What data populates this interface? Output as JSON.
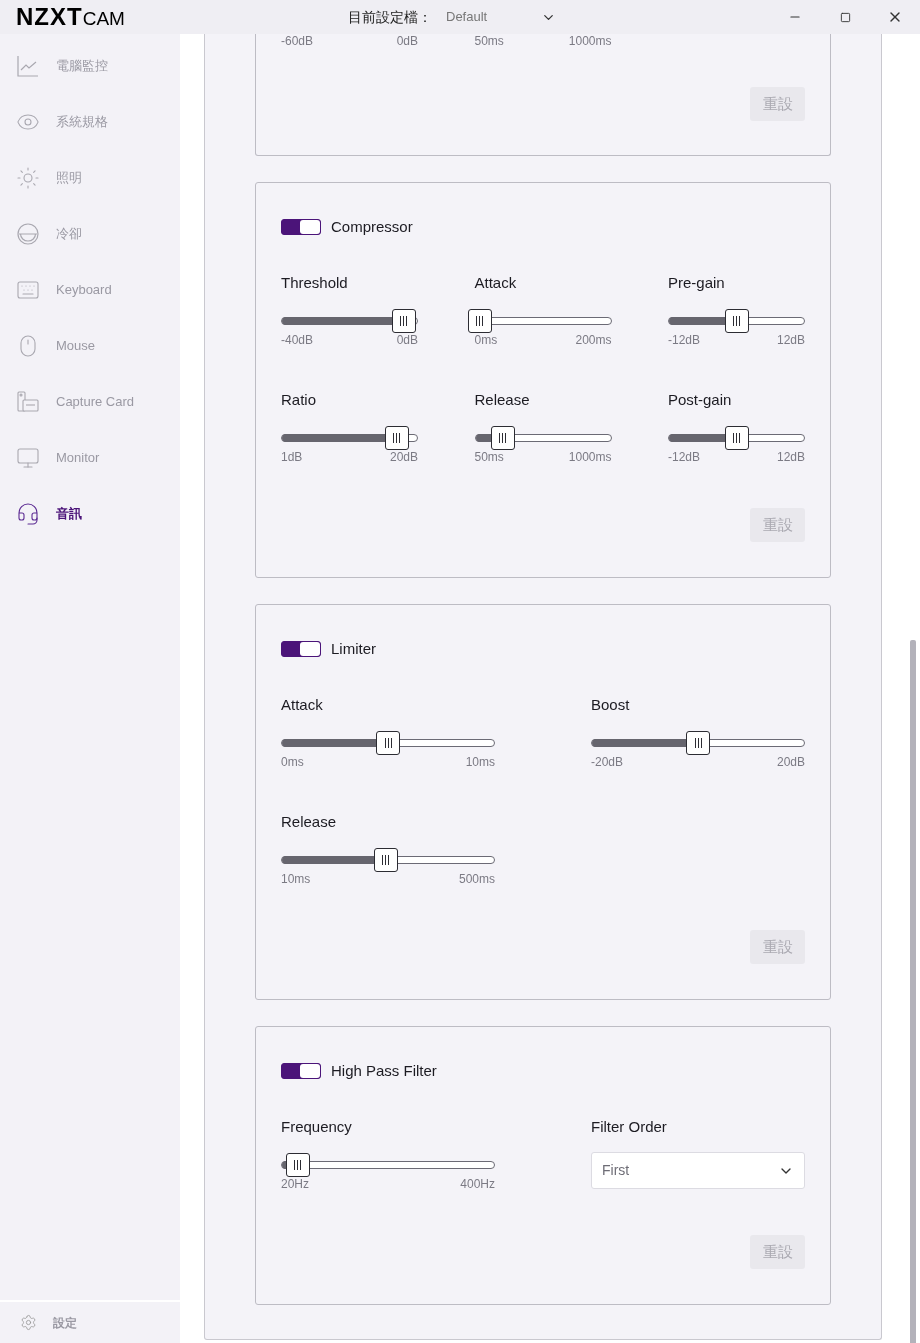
{
  "app": {
    "logo_bold": "NZXT",
    "logo_light": "CAM"
  },
  "profile": {
    "label": "目前設定檔：",
    "value": "Default"
  },
  "sidebar": {
    "items": [
      {
        "label": "電腦監控",
        "selected": false
      },
      {
        "label": "系統規格",
        "selected": false
      },
      {
        "label": "照明",
        "selected": false
      },
      {
        "label": "冷卻",
        "selected": false
      },
      {
        "label": "Keyboard",
        "selected": false
      },
      {
        "label": "Mouse",
        "selected": false
      },
      {
        "label": "Capture Card",
        "selected": false
      },
      {
        "label": "Monitor",
        "selected": false
      },
      {
        "label": "音訊",
        "selected": true
      }
    ],
    "footer": {
      "label": "設定"
    }
  },
  "partial_card": {
    "range_labels": [
      {
        "min": "-60dB",
        "max": "0dB"
      },
      {
        "min": "50ms",
        "max": "1000ms"
      }
    ],
    "reset": {
      "label": "重設",
      "disabled": true
    }
  },
  "cards": [
    {
      "title": "Compressor",
      "on": true,
      "controls": [
        {
          "kind": "slider",
          "label": "Threshold",
          "level": 0.9,
          "min": "-40dB",
          "max": "0dB"
        },
        {
          "kind": "slider",
          "label": "Attack",
          "level": 0.03,
          "min": "0ms",
          "max": "200ms"
        },
        {
          "kind": "slider",
          "label": "Pre-gain",
          "level": 0.5,
          "min": "-12dB",
          "max": "12dB"
        },
        {
          "kind": "slider",
          "label": "Ratio",
          "level": 0.85,
          "min": "1dB",
          "max": "20dB"
        },
        {
          "kind": "slider",
          "label": "Release",
          "level": 0.2,
          "min": "50ms",
          "max": "1000ms"
        },
        {
          "kind": "slider",
          "label": "Post-gain",
          "level": 0.5,
          "min": "-12dB",
          "max": "12dB"
        }
      ],
      "reset": {
        "label": "重設",
        "disabled": true
      }
    },
    {
      "title": "Limiter",
      "on": true,
      "controls": [
        {
          "kind": "slider",
          "label": "Attack",
          "level": 0.5,
          "min": "0ms",
          "max": "10ms"
        },
        {
          "kind": "slider",
          "label": "Boost",
          "level": 0.5,
          "min": "-20dB",
          "max": "20dB"
        },
        {
          "kind": "slider",
          "label": "Release",
          "level": 0.49,
          "min": "10ms",
          "max": "500ms"
        }
      ],
      "reset": {
        "label": "重設",
        "disabled": true
      }
    },
    {
      "title": "High Pass Filter",
      "on": true,
      "controls": [
        {
          "kind": "slider",
          "label": "Frequency",
          "level": 0.075,
          "min": "20Hz",
          "max": "400Hz"
        },
        {
          "kind": "select",
          "label": "Filter Order",
          "value": "First"
        }
      ],
      "reset": {
        "label": "重設",
        "disabled": true
      }
    }
  ]
}
